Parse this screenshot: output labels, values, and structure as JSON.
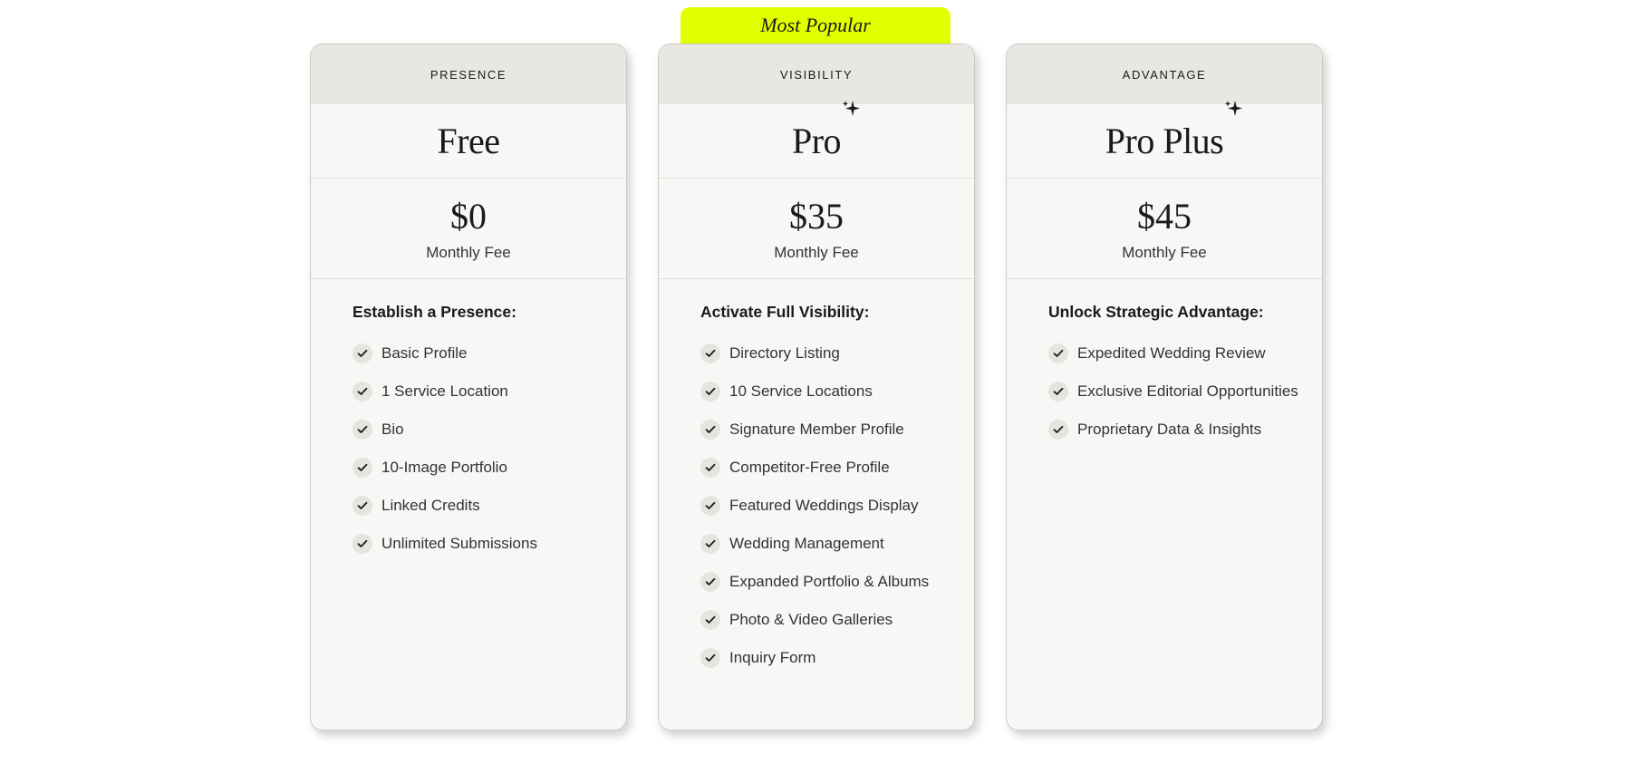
{
  "badge": {
    "label": "Most Popular",
    "color": "#e2ff00"
  },
  "plans": [
    {
      "tier": "PRESENCE",
      "name": "Free",
      "sparkle": false,
      "price": "$0",
      "fee_label": "Monthly Fee",
      "features_heading": "Establish a Presence:",
      "features": [
        "Basic Profile",
        "1 Service Location",
        "Bio",
        "10-Image Portfolio",
        "Linked Credits",
        "Unlimited Submissions"
      ]
    },
    {
      "tier": "VISIBILITY",
      "name": "Pro",
      "sparkle": true,
      "price": "$35",
      "fee_label": "Monthly Fee",
      "features_heading": "Activate Full Visibility:",
      "features": [
        "Directory Listing",
        "10 Service Locations",
        "Signature Member Profile",
        "Competitor-Free Profile",
        "Featured Weddings Display",
        "Wedding Management",
        "Expanded Portfolio & Albums",
        "Photo & Video Galleries",
        "Inquiry Form"
      ]
    },
    {
      "tier": "ADVANTAGE",
      "name": "Pro Plus",
      "sparkle": true,
      "price": "$45",
      "fee_label": "Monthly Fee",
      "features_heading": "Unlock Strategic Advantage:",
      "features": [
        "Expedited Wedding Review",
        "Exclusive Editorial Opportunities",
        "Proprietary Data & Insights"
      ]
    }
  ],
  "icons": {
    "feature_check": "check-icon",
    "name_decoration": "sparkle-icon"
  }
}
